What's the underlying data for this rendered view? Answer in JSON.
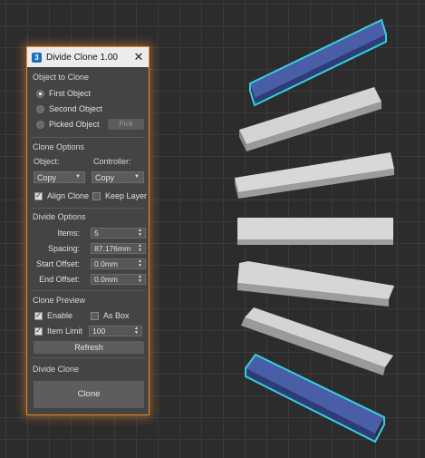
{
  "dialog": {
    "title": "Divide Clone 1.00",
    "logo_text": "3",
    "close_icon": "✕"
  },
  "object_to_clone": {
    "title": "Object to Clone",
    "options": [
      "First Object",
      "Second Object",
      "Picked Object"
    ],
    "selected": "First Object",
    "pick_label": "Pick"
  },
  "clone_options": {
    "title": "Clone Options",
    "object_label": "Object:",
    "controller_label": "Controller:",
    "object_value": "Copy",
    "controller_value": "Copy",
    "align_clone_label": "Align Clone",
    "align_clone_checked": true,
    "keep_layer_label": "Keep Layer",
    "keep_layer_checked": false
  },
  "divide_options": {
    "title": "Divide Options",
    "items_label": "Items:",
    "items_value": "5",
    "spacing_label": "Spacing:",
    "spacing_value": "87.176mm",
    "start_offset_label": "Start Offset:",
    "start_offset_value": "0.0mm",
    "end_offset_label": "End Offset:",
    "end_offset_value": "0.0mm"
  },
  "clone_preview": {
    "title": "Clone Preview",
    "enable_label": "Enable",
    "enable_checked": true,
    "as_box_label": "As Box",
    "as_box_checked": false,
    "item_limit_label": "Item Limit",
    "item_limit_checked": true,
    "item_limit_value": "100",
    "refresh_label": "Refresh"
  },
  "divide_clone": {
    "title": "Divide Clone",
    "clone_label": "Clone"
  },
  "colors": {
    "selection_outline": "#35d0e0",
    "selected_face": "#4a5ea8",
    "clone_face": "#d4d4d4",
    "dialog_border": "#e08a2e"
  }
}
